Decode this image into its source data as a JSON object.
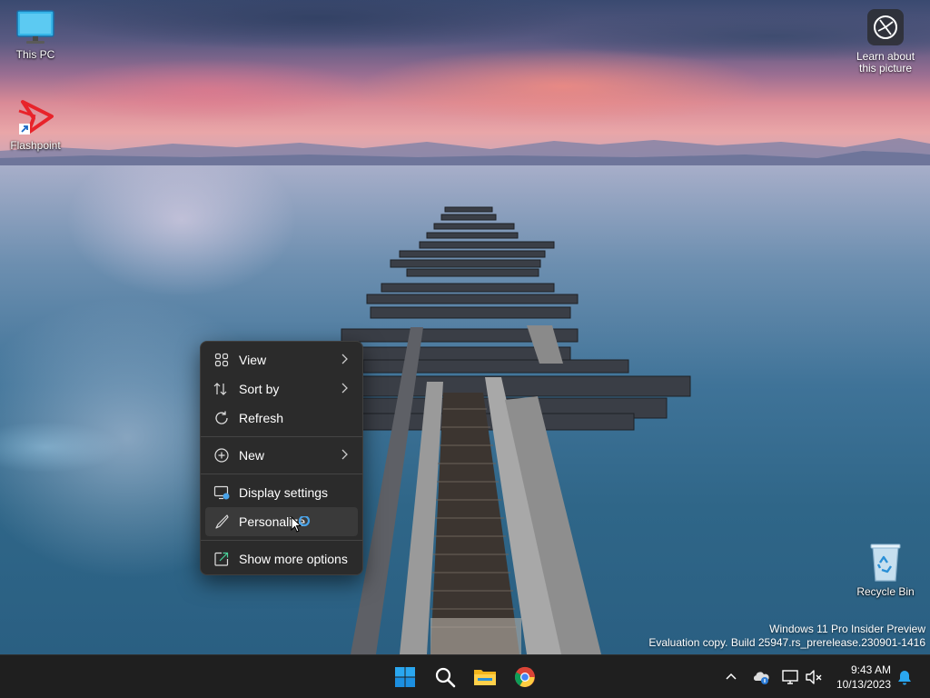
{
  "desktop": {
    "icons": [
      {
        "label": "This PC",
        "icon": "monitor-icon"
      },
      {
        "label": "Flashpoint",
        "icon": "flashpoint-logo-icon"
      },
      {
        "label": "Recycle Bin",
        "icon": "recycle-bin-icon"
      }
    ],
    "learn_about": {
      "label": "Learn about this picture",
      "icon": "camera-lens-icon"
    }
  },
  "context_menu": {
    "items": [
      {
        "label": "View",
        "icon": "grid-view-icon",
        "has_submenu": true
      },
      {
        "label": "Sort by",
        "icon": "sort-icon",
        "has_submenu": true
      },
      {
        "label": "Refresh",
        "icon": "refresh-icon",
        "has_submenu": false
      },
      {
        "label": "New",
        "icon": "plus-circle-icon",
        "has_submenu": true
      },
      {
        "label": "Display settings",
        "icon": "display-settings-icon",
        "has_submenu": false
      },
      {
        "label": "Personalize",
        "icon": "brush-icon",
        "has_submenu": false,
        "hovered": true
      },
      {
        "label": "Show more options",
        "icon": "share-arrow-icon",
        "has_submenu": false
      }
    ]
  },
  "watermark": {
    "line1": "Windows 11 Pro Insider Preview",
    "line2": "Evaluation copy. Build 25947.rs_prerelease.230901-1416"
  },
  "taskbar": {
    "apps": [
      {
        "name": "Start",
        "icon": "windows-start-icon"
      },
      {
        "name": "Search",
        "icon": "search-icon"
      },
      {
        "name": "File Explorer",
        "icon": "folder-icon"
      },
      {
        "name": "Google Chrome",
        "icon": "chrome-icon"
      }
    ],
    "tray": {
      "icons": [
        "chevron-up-icon",
        "onedrive-icon",
        "network-icon",
        "speaker-muted-icon"
      ],
      "time": "9:43 AM",
      "date": "10/13/2023",
      "notification_icon": "bell-icon"
    }
  },
  "colors": {
    "menu_bg": "#2b2b2b",
    "menu_hover": "#3a3a3a",
    "taskbar_bg": "#1f1f1f",
    "accent": "#0078d4"
  }
}
